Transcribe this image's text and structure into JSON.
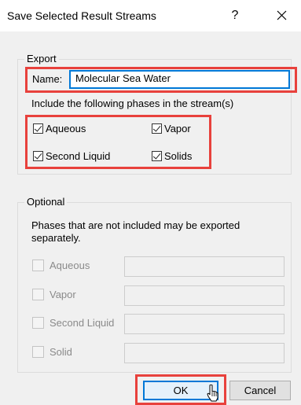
{
  "window": {
    "title": "Save Selected Result Streams",
    "help_label": "?",
    "close_icon": "close-icon"
  },
  "export": {
    "legend": "Export",
    "name_label": "Name:",
    "name_value": "Molecular Sea Water",
    "include_text": "Include the following phases in the stream(s)",
    "phases": [
      {
        "label": "Aqueous",
        "checked": true
      },
      {
        "label": "Vapor",
        "checked": true
      },
      {
        "label": "Second Liquid",
        "checked": true
      },
      {
        "label": "Solids",
        "checked": true
      }
    ]
  },
  "optional": {
    "legend": "Optional",
    "description": "Phases that are not included may be exported separately.",
    "rows": [
      {
        "label": "Aqueous",
        "checked": false,
        "value": ""
      },
      {
        "label": "Vapor",
        "checked": false,
        "value": ""
      },
      {
        "label": "Second Liquid",
        "checked": false,
        "value": ""
      },
      {
        "label": "Solid",
        "checked": false,
        "value": ""
      }
    ]
  },
  "buttons": {
    "ok_label": "OK",
    "cancel_label": "Cancel"
  },
  "colors": {
    "highlight": "#e8413c",
    "focus": "#0078d7"
  }
}
